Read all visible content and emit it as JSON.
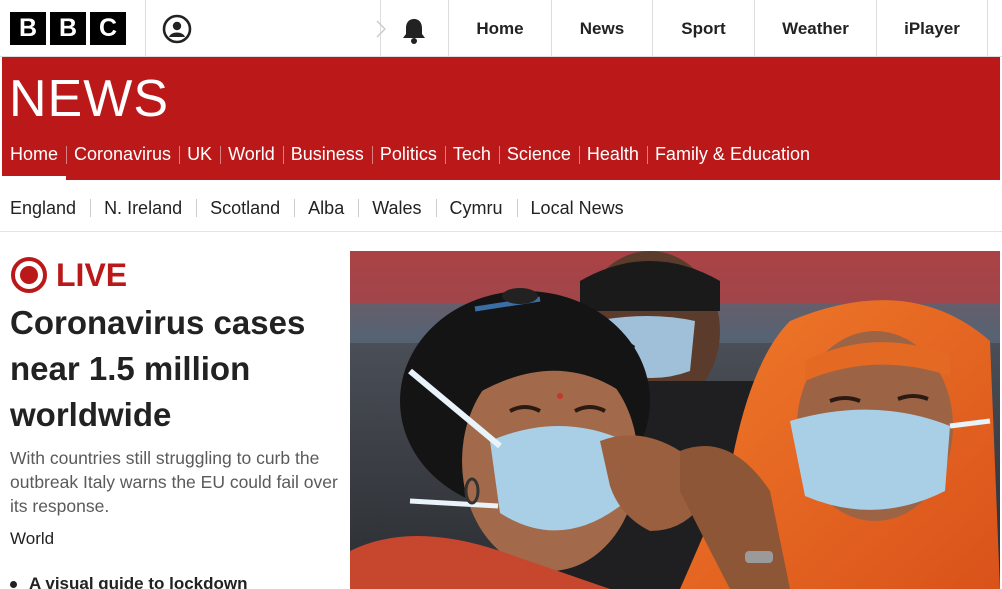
{
  "topbar": {
    "logo_letters": [
      "B",
      "B",
      "C"
    ],
    "account_icon": "user-account-icon",
    "notification_icon": "bell-icon",
    "nav": [
      {
        "label": "Home"
      },
      {
        "label": "News"
      },
      {
        "label": "Sport"
      },
      {
        "label": "Weather"
      },
      {
        "label": "iPlayer"
      }
    ]
  },
  "masthead": {
    "title": "NEWS",
    "background": "#bb1919",
    "nav": [
      {
        "label": "Home",
        "active": true
      },
      {
        "label": "Coronavirus"
      },
      {
        "label": "UK"
      },
      {
        "label": "World"
      },
      {
        "label": "Business"
      },
      {
        "label": "Politics"
      },
      {
        "label": "Tech"
      },
      {
        "label": "Science"
      },
      {
        "label": "Health"
      },
      {
        "label": "Family & Education"
      }
    ]
  },
  "subnav": [
    {
      "label": "England"
    },
    {
      "label": "N. Ireland"
    },
    {
      "label": "Scotland"
    },
    {
      "label": "Alba"
    },
    {
      "label": "Wales"
    },
    {
      "label": "Cymru"
    },
    {
      "label": "Local News"
    }
  ],
  "story": {
    "live_label": "LIVE",
    "headline": "Coronavirus cases near 1.5 million worldwide",
    "summary": "With countries still struggling to curb the outbreak Italy warns the EU could fail over its response.",
    "section": "World",
    "related": [
      {
        "label": "A visual guide to lockdown"
      }
    ]
  },
  "image": {
    "icon": "news-photo-masked-women"
  }
}
